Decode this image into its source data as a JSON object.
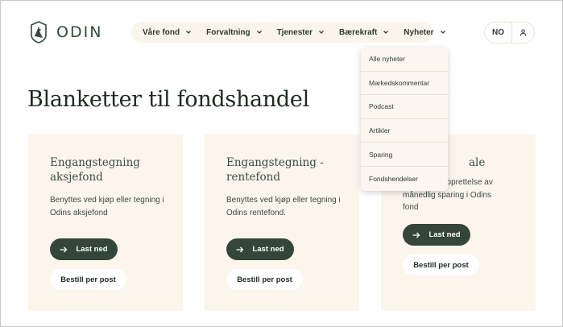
{
  "brand": {
    "name": "ODIN",
    "accent": "#344637",
    "cream": "#fbf5ec"
  },
  "nav": {
    "items": [
      {
        "label": "Våre fond"
      },
      {
        "label": "Forvaltning"
      },
      {
        "label": "Tjenester"
      },
      {
        "label": "Bærekraft"
      },
      {
        "label": "Nyheter"
      }
    ],
    "language": "NO"
  },
  "dropdown": {
    "items": [
      "Alle nyheter",
      "Markedskommentar",
      "Podcast",
      "Artikler",
      "Sparing",
      "Fondshendelser"
    ]
  },
  "page": {
    "title": "Blanketter til fondshandel"
  },
  "cards": [
    {
      "title": "Engangstegning aksjefond",
      "text": "Benyttes ved kjøp eller tegning i Odins aksjefond",
      "download": "Last ned",
      "order": "Bestill per post"
    },
    {
      "title": "Engangstegning - rentefond",
      "text": "Benyttes ved kjøp eller tegning i Odins rentefond.",
      "download": "Last ned",
      "order": "Bestill per post"
    },
    {
      "title": "ale",
      "text": "opprettelse av månedlig sparing i Odins fond",
      "download": "Last ned",
      "order": "Bestill per post"
    }
  ]
}
